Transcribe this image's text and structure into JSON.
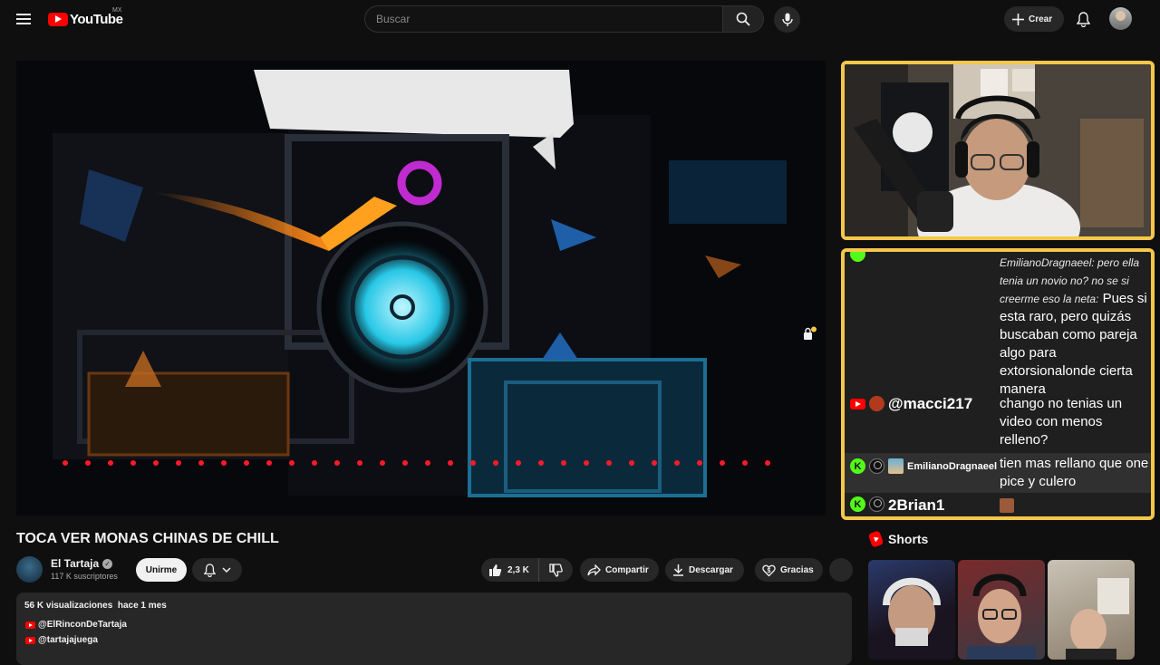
{
  "header": {
    "logo_text": "YouTube",
    "region": "MX",
    "search_placeholder": "Buscar",
    "create_label": "Crear"
  },
  "chat": {
    "messages": [
      {
        "text_italic": "EmilianoDragnaeel: pero ella tenia un novio no? no se si creerme eso la neta:",
        "text": "Pues si esta raro, pero quizás buscaban como pareja algo para extorsionalonde cierta manera"
      },
      {
        "username": "@macci217",
        "text": "chango no tenias un video con menos relleno?"
      },
      {
        "username": "EmilianoDragnaeel",
        "text": "tien mas rellano que one pice y culero"
      },
      {
        "username": "2Brian1",
        "text": ""
      }
    ]
  },
  "video": {
    "title": "TOCA VER MONAS CHINAS DE CHILL",
    "channel_name": "El Tartaja",
    "subscribers": "117 K suscriptores",
    "join_label": "Unirme",
    "likes": "2,3 K",
    "share_label": "Compartir",
    "download_label": "Descargar",
    "thanks_label": "Gracias"
  },
  "description": {
    "views": "56 K visualizaciones",
    "date": "hace 1 mes",
    "links": [
      "@ElRinconDeTartaja",
      "@tartajajuega"
    ]
  },
  "sidebar": {
    "shorts_title": "Shorts"
  },
  "colors": {
    "accent": "#ff0000",
    "overlay_border": "#f5c84a",
    "kick_green": "#53fc18"
  }
}
